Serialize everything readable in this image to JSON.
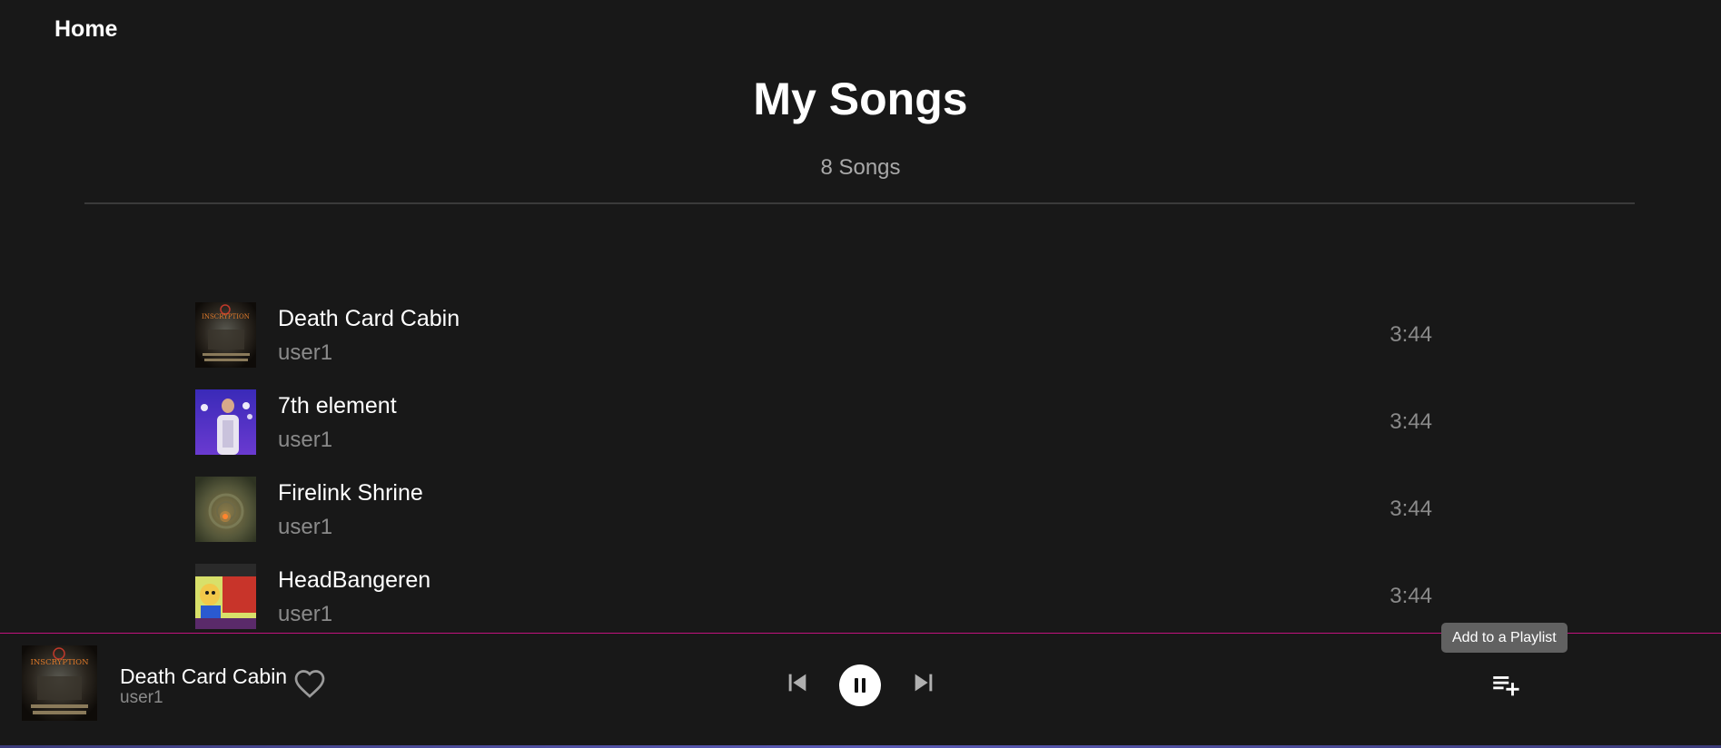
{
  "nav": {
    "home_label": "Home"
  },
  "header": {
    "title": "My Songs",
    "song_count": "8 Songs"
  },
  "songs": [
    {
      "title": "Death Card Cabin",
      "artist": "user1",
      "duration": "3:44",
      "art": "inscryption-cover"
    },
    {
      "title": "7th element",
      "artist": "user1",
      "duration": "3:44",
      "art": "singer-on-stage"
    },
    {
      "title": "Firelink Shrine",
      "artist": "user1",
      "duration": "3:44",
      "art": "shrine-ruins"
    },
    {
      "title": "HeadBangeren",
      "artist": "user1",
      "duration": "3:44",
      "art": "cartoon-headbanger"
    }
  ],
  "player": {
    "title": "Death Card Cabin",
    "artist": "user1",
    "art": "inscryption-cover",
    "state": "playing",
    "tooltip": "Add to a Playlist"
  },
  "colors": {
    "background": "#181818",
    "player_top_border": "#c2127e",
    "muted_text": "#8a8a8a",
    "tooltip_bg": "#616161"
  },
  "icons": {
    "like": "heart-outline-icon",
    "prev": "skip-previous-icon",
    "play_pause": "pause-icon",
    "next": "skip-next-icon",
    "add_playlist": "playlist-add-icon"
  }
}
